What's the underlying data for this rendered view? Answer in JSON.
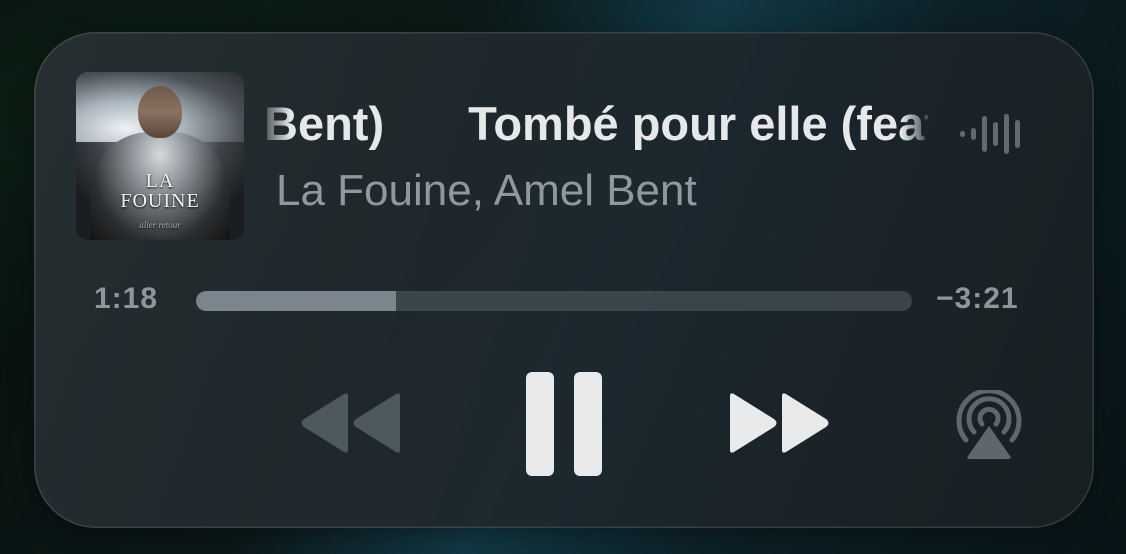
{
  "now_playing": {
    "title_marquee": [
      "Bent)",
      "Tombé pour elle (feat. Amel Bent)"
    ],
    "artist": "La Fouine, Amel Bent",
    "artwork": {
      "logo_line1": "LA",
      "logo_line2": "FOUINE",
      "logo_tagline": "aller retour"
    }
  },
  "playback": {
    "elapsed": "1:18",
    "remaining": "−3:21",
    "progress_fraction": 0.28,
    "state": "playing"
  },
  "controls": {
    "rewind_icon": "backward-icon",
    "pause_icon": "pause-icon",
    "forward_icon": "forward-icon",
    "airplay_icon": "airplay-icon",
    "waveform_icon": "waveform-icon"
  },
  "colors": {
    "primary_text": "#e6e8ea",
    "secondary_text": "#8e989f",
    "progress_fill": "#7b858d",
    "progress_track": "#465056",
    "control_active": "#e8eaec",
    "control_dim": "#4e595f"
  }
}
